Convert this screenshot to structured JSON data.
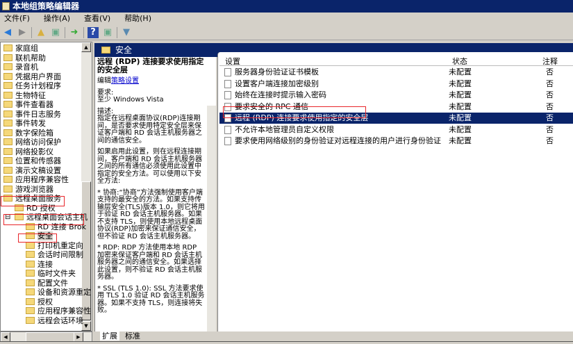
{
  "window": {
    "title": "本地组策略编辑器"
  },
  "menu": [
    "文件(F)",
    "操作(A)",
    "查看(V)",
    "帮助(H)"
  ],
  "tree": {
    "items": [
      "家庭组",
      "联机帮助",
      "录音机",
      "凭据用户界面",
      "任务计划程序",
      "生物特征",
      "事件查看器",
      "事件日志服务",
      "事件转发",
      "数字保险箱",
      "网络访问保护",
      "网络投影仪",
      "位置和传感器",
      "演示文稿设置",
      "应用程序兼容性",
      "游戏浏览器",
      "远程桌面服务",
      "RD 授权",
      "远程桌面会话主机",
      "RD 连接 Brok",
      "安全",
      "打印机重定向",
      "会话时间限制",
      "连接",
      "临时文件夹",
      "配置文件",
      "设备和资源重定向",
      "授权",
      "应用程序兼容性",
      "远程会话环境"
    ],
    "expander": "⊟"
  },
  "header": {
    "title": "安全"
  },
  "description": {
    "title": "远程 (RDP) 连接要求使用指定的安全层",
    "edit_prefix": "编辑",
    "edit_link": "策略设置",
    "req_label": "要求:",
    "req_value": "至少 Windows Vista",
    "desc_label": "描述:",
    "p1": "指定在远程桌面协议(RDP)连接期间，是否要求使用特定安全层来保证客户端和 RD 会话主机服务器之间的通信安全。",
    "p2": "如果启用此设置，则在远程连接期间，客户端和 RD 会话主机服务器之间的所有通信必须使用此设置中指定的安全方法。可以使用以下安全方法:",
    "p3": "* 协商:“协商”方法强制使用客户端支持的最安全的方法。如果支持传输层安全(TLS)版本 1.0，则它将用于验证 RD 会话主机服务器。如果不支持 TLS，则使用本地远程桌面协议(RDP)加密来保证通信安全，但不验证 RD 会话主机服务器。",
    "p4": "* RDP: RDP 方法使用本地 RDP 加密来保证客户端和 RD 会话主机服务器之间的通信安全。如果选择此设置，则不验证 RD 会话主机服务器。",
    "p5": "* SSL (TLS 1.0): SSL 方法要求使用 TLS 1.0 验证 RD 会话主机服务器。如果不支持 TLS，则连接将失败。"
  },
  "list": {
    "columns": [
      "设置",
      "状态",
      "注释"
    ],
    "rows": [
      {
        "name": "服务器身份验证证书模板",
        "state": "未配置",
        "comment": "否"
      },
      {
        "name": "设置客户端连接加密级别",
        "state": "未配置",
        "comment": "否"
      },
      {
        "name": "始终在连接时提示输入密码",
        "state": "未配置",
        "comment": "否"
      },
      {
        "name": "要求安全的 RPC 通信",
        "state": "未配置",
        "comment": "否"
      },
      {
        "name": "远程 (RDP) 连接要求使用指定的安全层",
        "state": "未配置",
        "comment": "否"
      },
      {
        "name": "不允许本地管理员自定义权限",
        "state": "未配置",
        "comment": "否"
      },
      {
        "name": "要求使用网络级别的身份验证对远程连接的用户进行身份验证",
        "state": "未配置",
        "comment": "否"
      }
    ]
  },
  "tabs": [
    "扩展",
    "标准"
  ]
}
